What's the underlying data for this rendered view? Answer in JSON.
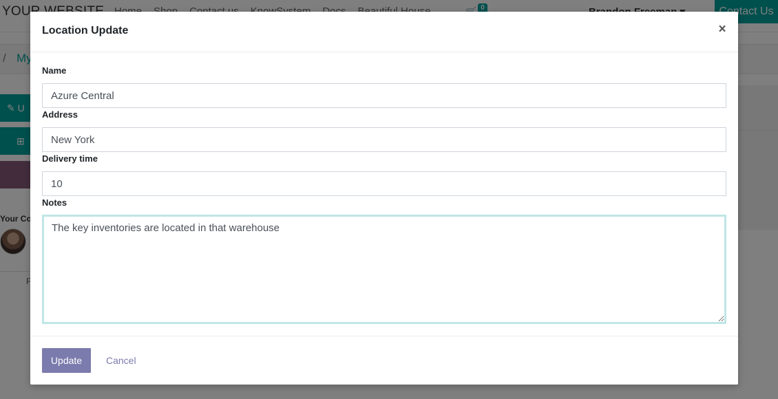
{
  "website": {
    "brand": "YOUR WEBSITE",
    "menu": [
      "Home",
      "Shop",
      "Contact us",
      "KnowSystem",
      "Docs",
      "Beautiful House"
    ],
    "cart_count": "0",
    "user_name": "Brandon Freeman",
    "contact_button": "Contact Us",
    "breadcrumb_separator": "/",
    "breadcrumb_link": "My",
    "side_update_label": "U",
    "your_contact_label": "Your Co",
    "side_letter": "F",
    "accent_color": "#00a09d"
  },
  "modal": {
    "title": "Location Update",
    "close_label": "×",
    "fields": {
      "name": {
        "label": "Name",
        "value": "Azure Central"
      },
      "address": {
        "label": "Address",
        "value": "New York"
      },
      "delivery_time": {
        "label": "Delivery time",
        "value": "10"
      },
      "notes": {
        "label": "Notes",
        "value": "The key inventories are located in that warehouse"
      }
    },
    "update_button": "Update",
    "cancel_button": "Cancel",
    "primary_color": "#7c7bad"
  }
}
